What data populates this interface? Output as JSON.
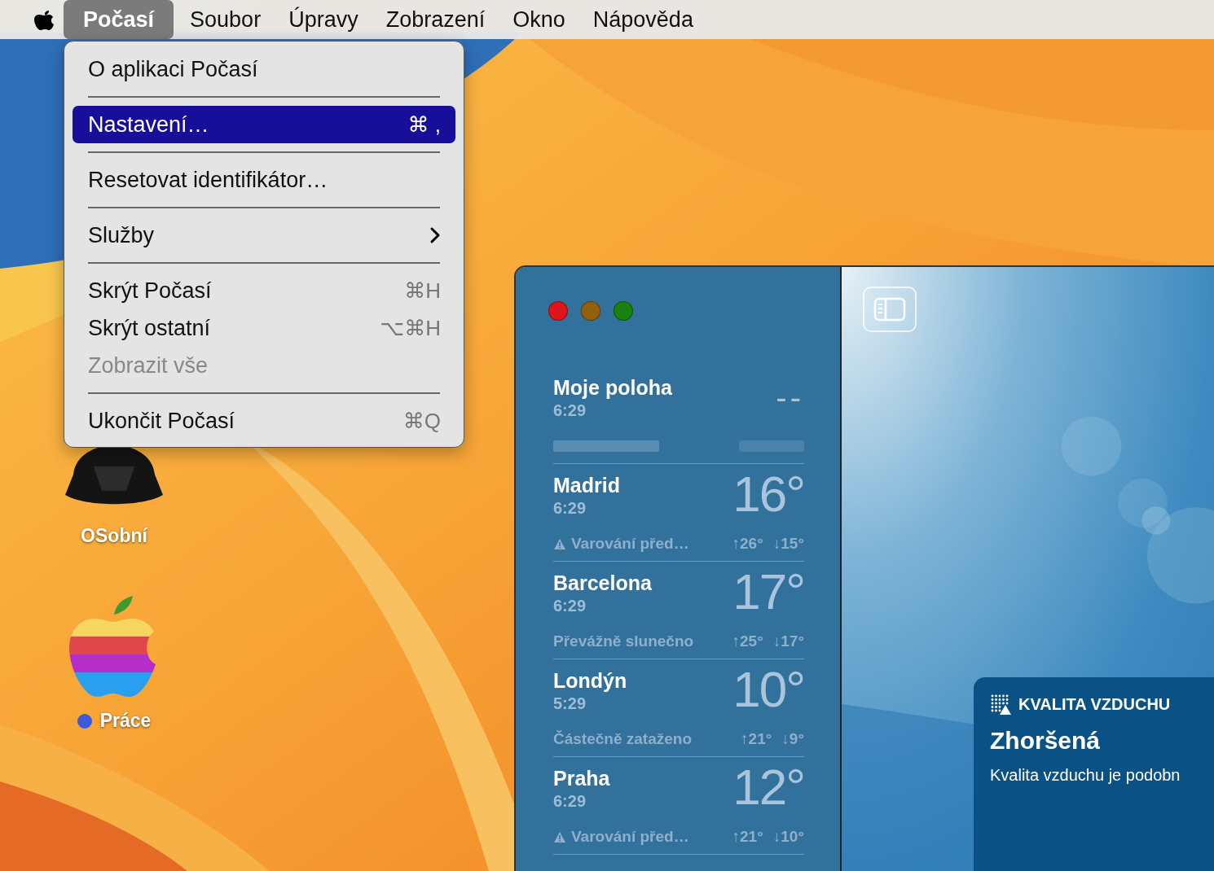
{
  "menu_bar": {
    "items": [
      {
        "label": "Počasí",
        "selected": true
      },
      {
        "label": "Soubor",
        "selected": false
      },
      {
        "label": "Úpravy",
        "selected": false
      },
      {
        "label": "Zobrazení",
        "selected": false
      },
      {
        "label": "Okno",
        "selected": false
      },
      {
        "label": "Nápověda",
        "selected": false
      }
    ]
  },
  "app_menu": {
    "items": [
      {
        "kind": "item",
        "label": "O aplikaci Počasí",
        "selected": false,
        "disabled": false
      },
      {
        "kind": "separator"
      },
      {
        "kind": "item",
        "label": "Nastavení…",
        "shortcut": "⌘ ,",
        "selected": true,
        "disabled": false
      },
      {
        "kind": "separator"
      },
      {
        "kind": "item",
        "label": "Resetovat identifikátor…",
        "selected": false,
        "disabled": false
      },
      {
        "kind": "separator"
      },
      {
        "kind": "submenu",
        "label": "Služby",
        "selected": false,
        "disabled": false
      },
      {
        "kind": "separator"
      },
      {
        "kind": "item",
        "label": "Skrýt Počasí",
        "shortcut": "⌘H",
        "selected": false,
        "disabled": false
      },
      {
        "kind": "item",
        "label": "Skrýt ostatní",
        "shortcut": "⌥⌘H",
        "selected": false,
        "disabled": false
      },
      {
        "kind": "item",
        "label": "Zobrazit vše",
        "selected": false,
        "disabled": true
      },
      {
        "kind": "separator"
      },
      {
        "kind": "item",
        "label": "Ukončit Počasí",
        "shortcut": "⌘Q",
        "selected": false,
        "disabled": false
      }
    ]
  },
  "desktop_icons": [
    {
      "kind": "dark",
      "label": "OSobní"
    },
    {
      "kind": "apple",
      "label": "Práce",
      "color": "#3a5bdc"
    }
  ],
  "window": {
    "controls": [
      {
        "color": "#e0141b"
      },
      {
        "color": "#95600e"
      },
      {
        "color": "#1a800e"
      }
    ],
    "cities": [
      {
        "kind": "loading",
        "name": "Moje poloha",
        "time": "6:29",
        "temperature": "--"
      },
      {
        "kind": "city",
        "name": "Madrid",
        "time": "6:29",
        "temperature": "16°",
        "warning": true,
        "condition": "Varování před…",
        "high": "↑26°",
        "low": "↓15°"
      },
      {
        "kind": "city",
        "name": "Barcelona",
        "time": "6:29",
        "temperature": "17°",
        "warning": false,
        "condition": "Převážně slunečno",
        "high": "↑25°",
        "low": "↓17°"
      },
      {
        "kind": "city",
        "name": "Londýn",
        "time": "5:29",
        "temperature": "10°",
        "warning": false,
        "condition": "Částečně zataženo",
        "high": "↑21°",
        "low": "↓9°"
      },
      {
        "kind": "city",
        "name": "Praha",
        "time": "6:29",
        "temperature": "12°",
        "warning": true,
        "condition": "Varování před…",
        "high": "↑21°",
        "low": "↓10°"
      }
    ],
    "air_quality": {
      "title": "KVALITA VZDUCHU",
      "status": "Zhoršená",
      "description": "Kvalita vzduchu je podobn"
    }
  }
}
